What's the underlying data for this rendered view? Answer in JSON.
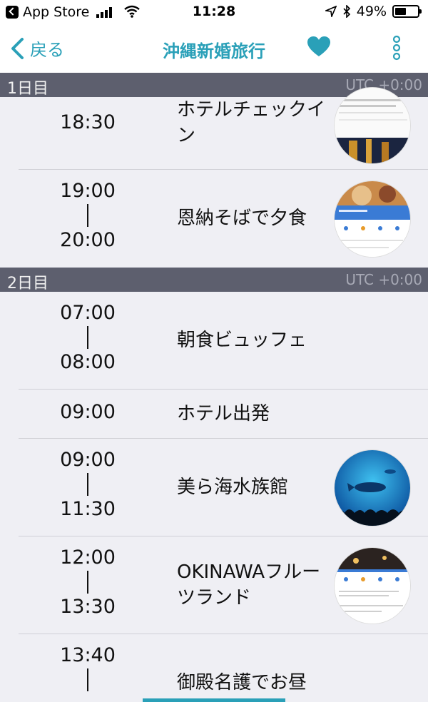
{
  "status_bar": {
    "back_app": "App Store",
    "time": "11:28",
    "battery": "49%",
    "battery_level": 0.49
  },
  "nav": {
    "back_label": "戻る",
    "title": "沖縄新婚旅行",
    "accent": "#2aa0b8"
  },
  "sections": [
    {
      "day": "1日目",
      "tz": "UTC +0:00"
    },
    {
      "day": "2日目",
      "tz": "UTC +0:00"
    }
  ],
  "items": [
    {
      "start": "18:30",
      "end": "",
      "title": "ホテルチェックイン",
      "thumb": "hotel-map-thumbnail"
    },
    {
      "start": "19:00",
      "end": "20:00",
      "title": "恩納そばで夕食",
      "thumb": "restaurant-map-thumbnail"
    },
    {
      "start": "07:00",
      "end": "08:00",
      "title": "朝食ビュッフェ",
      "thumb": ""
    },
    {
      "start": "09:00",
      "end": "",
      "title": "ホテル出発",
      "thumb": ""
    },
    {
      "start": "09:00",
      "end": "11:30",
      "title": "美ら海水族館",
      "thumb": "aquarium-photo-thumbnail"
    },
    {
      "start": "12:00",
      "end": "13:30",
      "title": "OKINAWAフルーツランド",
      "thumb": "fruitland-map-thumbnail"
    },
    {
      "start": "13:40",
      "end": "",
      "title": "御殿名護でお昼",
      "thumb": ""
    }
  ]
}
